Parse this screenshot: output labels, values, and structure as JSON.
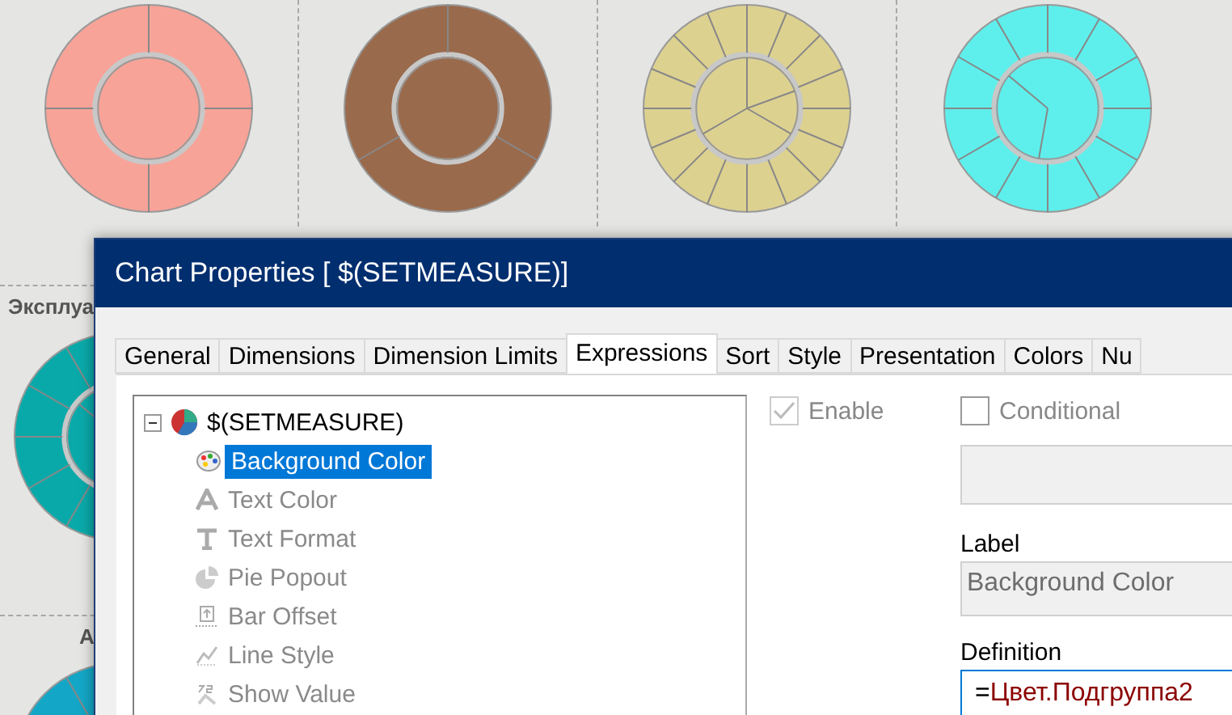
{
  "dashboard": {
    "donuts": [
      {
        "color": "#f8a398"
      },
      {
        "color": "#9a6a4c"
      },
      {
        "color": "#ddd190"
      },
      {
        "color": "#5eefec"
      }
    ],
    "sections": [
      {
        "title": "Эксплуа",
        "color": "#0aa9a9"
      },
      {
        "title": "А",
        "color": "#14a6c6"
      }
    ]
  },
  "dialog": {
    "title": "Chart Properties [ $(SETMEASURE)]",
    "tabs": [
      {
        "label": "General",
        "selected": false
      },
      {
        "label": "Dimensions",
        "selected": false
      },
      {
        "label": "Dimension Limits",
        "selected": false
      },
      {
        "label": "Expressions",
        "selected": true
      },
      {
        "label": "Sort",
        "selected": false
      },
      {
        "label": "Style",
        "selected": false
      },
      {
        "label": "Presentation",
        "selected": false
      },
      {
        "label": "Colors",
        "selected": false
      },
      {
        "label": "Nu",
        "selected": false
      }
    ],
    "tree": {
      "label": "$(SETMEASURE)",
      "expanded": true,
      "children": [
        {
          "label": "Background Color",
          "selected": true,
          "disabled": false
        },
        {
          "label": "Text Color",
          "selected": false,
          "disabled": true
        },
        {
          "label": "Text Format",
          "selected": false,
          "disabled": true
        },
        {
          "label": "Pie Popout",
          "selected": false,
          "disabled": true
        },
        {
          "label": "Bar Offset",
          "selected": false,
          "disabled": true
        },
        {
          "label": "Line Style",
          "selected": false,
          "disabled": true
        },
        {
          "label": "Show Value",
          "selected": false,
          "disabled": true
        }
      ]
    },
    "enable": {
      "label": "Enable",
      "checked": true,
      "disabled": true
    },
    "conditional": {
      "label": "Conditional",
      "checked": false
    },
    "label_field": {
      "caption": "Label",
      "value": "Background Color"
    },
    "definition": {
      "caption": "Definition",
      "operator": "=",
      "expression": "Цвет.Подгруппа2"
    }
  }
}
